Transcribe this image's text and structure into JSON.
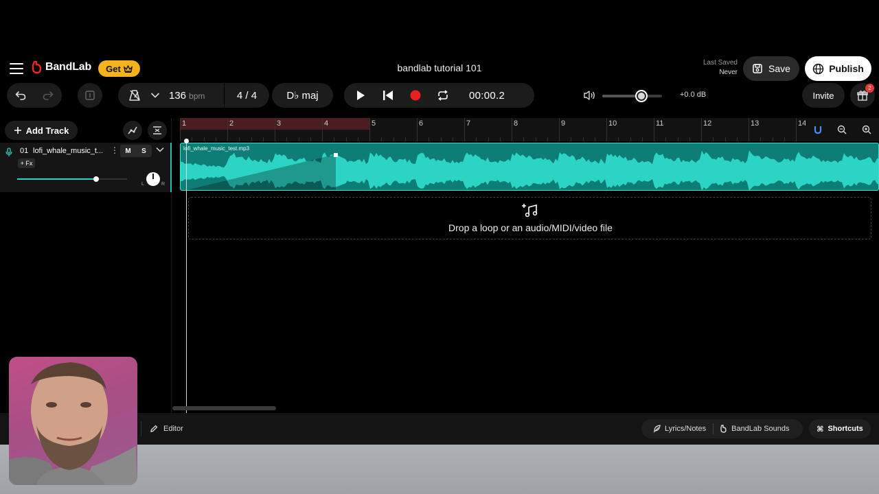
{
  "header": {
    "app_name": "BandLab",
    "get_label": "Get",
    "project_title": "bandlab tutorial 101",
    "last_saved_label": "Last Saved",
    "last_saved_value": "Never",
    "save_label": "Save",
    "publish_label": "Publish"
  },
  "toolbar": {
    "bpm": "136",
    "bpm_unit": "bpm",
    "time_signature": "4 / 4",
    "key": "D♭ maj",
    "time": "00:00.2",
    "master_volume": 0.66,
    "db_value": "+0.0 dB",
    "invite_label": "Invite",
    "gift_badge": "2",
    "colors": {
      "record": "#e8201e",
      "accent": "#2bd4c4",
      "get_button": "#f5b31b"
    }
  },
  "tracks_panel": {
    "add_track_label": "Add Track",
    "track": {
      "number": "01",
      "name": "lofi_whale_music_t...",
      "mute_label": "M",
      "solo_label": "S",
      "fx_label": "+ Fx",
      "volume": 0.72,
      "pan_left": "L",
      "pan_right": "R"
    }
  },
  "timeline": {
    "bars": [
      "1",
      "2",
      "3",
      "4",
      "5",
      "6",
      "7",
      "8",
      "9",
      "10",
      "11",
      "12",
      "13",
      "14"
    ],
    "clip_name": "lofi_whale_music_test.mp3",
    "drop_text": "Drop a loop or an audio/MIDI/video file"
  },
  "bottom_bar": {
    "editor_label": "Editor",
    "lyrics_label": "Lyrics/Notes",
    "sounds_label": "BandLab Sounds",
    "shortcuts_label": "Shortcuts"
  }
}
